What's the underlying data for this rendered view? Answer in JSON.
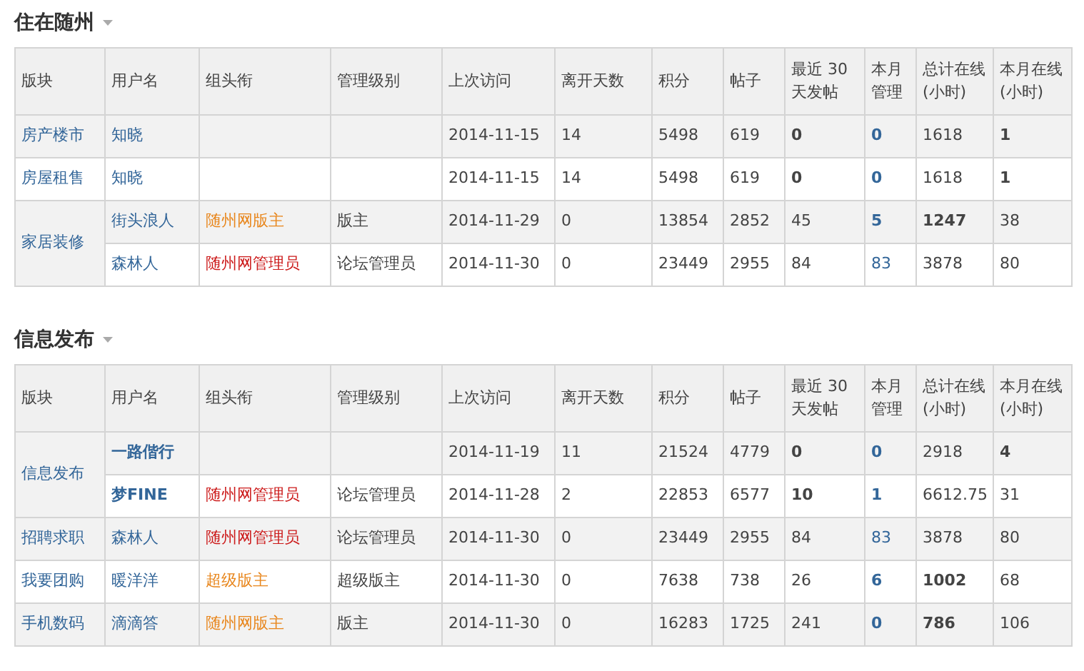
{
  "sections": [
    {
      "title": "住在随州",
      "columns": [
        "版块",
        "用户名",
        "组头衔",
        "管理级别",
        "上次访问",
        "离开天数",
        "积分",
        "帖子",
        "最近 30\n天发帖",
        "本月管理",
        "总计在线\n(小时)",
        "本月在线\n(小时)"
      ],
      "groups": [
        {
          "board": "房产楼市",
          "rows": [
            {
              "username": {
                "text": "知晓",
                "bold": false
              },
              "last_visit": "2014-11-15",
              "days_away": "14",
              "points": "5498",
              "posts": "619",
              "posts_30d": {
                "text": "0",
                "bold": true
              },
              "month_manage": {
                "text": "0",
                "bold": true
              },
              "total_online": {
                "text": "1618",
                "bold": false
              },
              "month_online": {
                "text": "1",
                "bold": true
              }
            }
          ]
        },
        {
          "board": "房屋租售",
          "rows": [
            {
              "username": {
                "text": "知晓",
                "bold": false
              },
              "last_visit": "2014-11-15",
              "days_away": "14",
              "points": "5498",
              "posts": "619",
              "posts_30d": {
                "text": "0",
                "bold": true
              },
              "month_manage": {
                "text": "0",
                "bold": true
              },
              "total_online": {
                "text": "1618",
                "bold": false
              },
              "month_online": {
                "text": "1",
                "bold": true
              }
            }
          ]
        },
        {
          "board": "家居装修",
          "rows": [
            {
              "username": {
                "text": "街头浪人",
                "bold": false
              },
              "group_title": {
                "text": "随州网版主",
                "color": "#e8861c"
              },
              "level": "版主",
              "last_visit": "2014-11-29",
              "days_away": "0",
              "points": "13854",
              "posts": "2852",
              "posts_30d": {
                "text": "45",
                "bold": false
              },
              "month_manage": {
                "text": "5",
                "bold": true
              },
              "total_online": {
                "text": "1247",
                "bold": true
              },
              "month_online": {
                "text": "38",
                "bold": false
              }
            },
            {
              "username": {
                "text": "森林人",
                "bold": false
              },
              "group_title": {
                "text": "随州网管理员",
                "color": "#cc1a1a"
              },
              "level": "论坛管理员",
              "last_visit": "2014-11-30",
              "days_away": "0",
              "points": "23449",
              "posts": "2955",
              "posts_30d": {
                "text": "84",
                "bold": false
              },
              "month_manage": {
                "text": "83",
                "bold": false
              },
              "total_online": {
                "text": "3878",
                "bold": false
              },
              "month_online": {
                "text": "80",
                "bold": false
              }
            }
          ]
        }
      ]
    },
    {
      "title": "信息发布",
      "columns": [
        "版块",
        "用户名",
        "组头衔",
        "管理级别",
        "上次访问",
        "离开天数",
        "积分",
        "帖子",
        "最近 30\n天发帖",
        "本月管理",
        "总计在线\n(小时)",
        "本月在线\n(小时)"
      ],
      "groups": [
        {
          "board": "信息发布",
          "rows": [
            {
              "username": {
                "text": "一路偕行",
                "bold": true
              },
              "last_visit": "2014-11-19",
              "days_away": "11",
              "points": "21524",
              "posts": "4779",
              "posts_30d": {
                "text": "0",
                "bold": true
              },
              "month_manage": {
                "text": "0",
                "bold": true
              },
              "total_online": {
                "text": "2918",
                "bold": false
              },
              "month_online": {
                "text": "4",
                "bold": true
              }
            },
            {
              "username": {
                "text": "梦FINE",
                "bold": true
              },
              "group_title": {
                "text": "随州网管理员",
                "color": "#cc1a1a"
              },
              "level": "论坛管理员",
              "last_visit": "2014-11-28",
              "days_away": "2",
              "points": "22853",
              "posts": "6577",
              "posts_30d": {
                "text": "10",
                "bold": true
              },
              "month_manage": {
                "text": "1",
                "bold": true
              },
              "total_online": {
                "text": "6612.75",
                "bold": false
              },
              "month_online": {
                "text": "31",
                "bold": false
              }
            }
          ]
        },
        {
          "board": "招聘求职",
          "rows": [
            {
              "username": {
                "text": "森林人",
                "bold": false
              },
              "group_title": {
                "text": "随州网管理员",
                "color": "#cc1a1a"
              },
              "level": "论坛管理员",
              "last_visit": "2014-11-30",
              "days_away": "0",
              "points": "23449",
              "posts": "2955",
              "posts_30d": {
                "text": "84",
                "bold": false
              },
              "month_manage": {
                "text": "83",
                "bold": false
              },
              "total_online": {
                "text": "3878",
                "bold": false
              },
              "month_online": {
                "text": "80",
                "bold": false
              }
            }
          ]
        },
        {
          "board": "我要团购",
          "rows": [
            {
              "username": {
                "text": "暖洋洋",
                "bold": false
              },
              "group_title": {
                "text": "超级版主",
                "color": "#e8861c"
              },
              "level": "超级版主",
              "last_visit": "2014-11-30",
              "days_away": "0",
              "points": "7638",
              "posts": "738",
              "posts_30d": {
                "text": "26",
                "bold": false
              },
              "month_manage": {
                "text": "6",
                "bold": true
              },
              "total_online": {
                "text": "1002",
                "bold": true
              },
              "month_online": {
                "text": "68",
                "bold": false
              }
            }
          ]
        },
        {
          "board": "手机数码",
          "rows": [
            {
              "username": {
                "text": "滴滴答",
                "bold": false
              },
              "group_title": {
                "text": "随州网版主",
                "color": "#e8861c"
              },
              "level": "版主",
              "last_visit": "2014-11-30",
              "days_away": "0",
              "points": "16283",
              "posts": "1725",
              "posts_30d": {
                "text": "241",
                "bold": false
              },
              "month_manage": {
                "text": "0",
                "bold": true
              },
              "total_online": {
                "text": "786",
                "bold": true
              },
              "month_online": {
                "text": "106",
                "bold": false
              }
            }
          ]
        }
      ]
    }
  ]
}
